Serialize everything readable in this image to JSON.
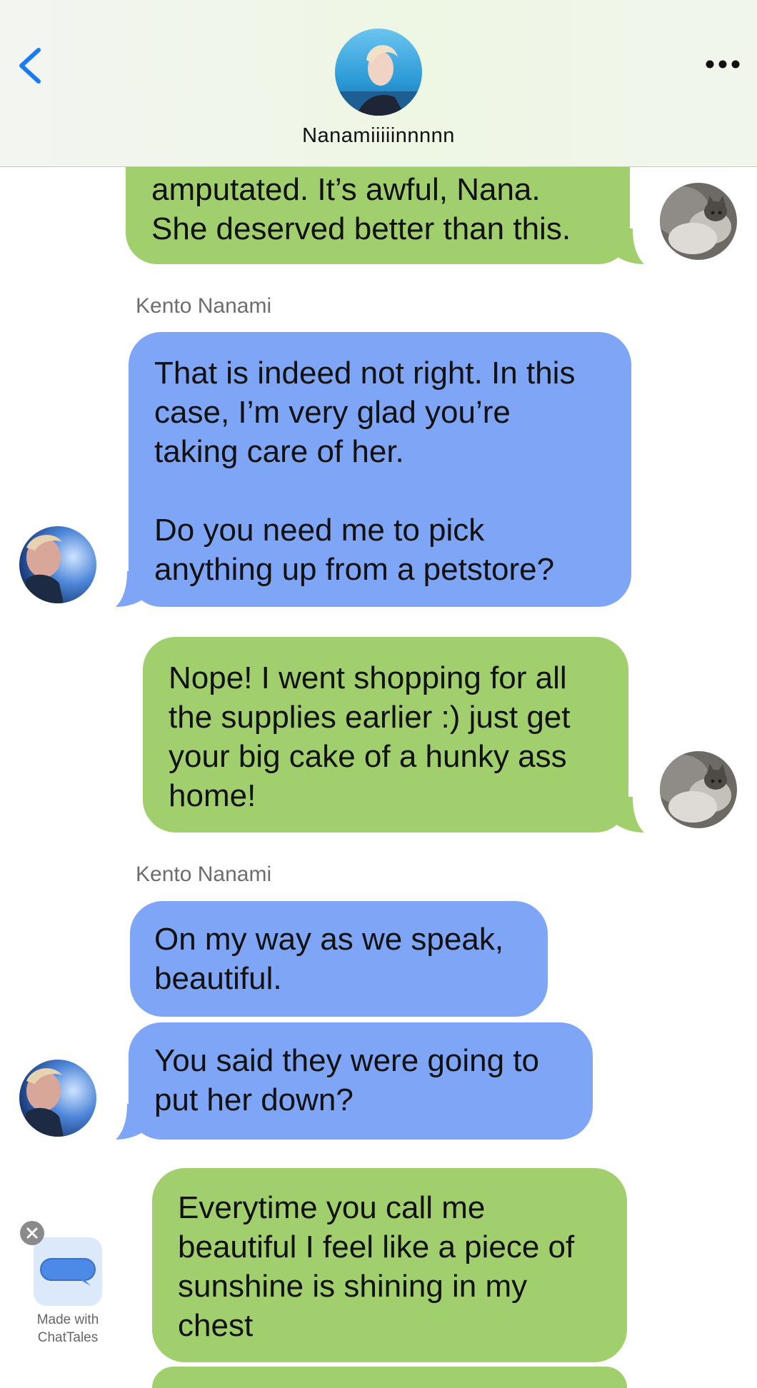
{
  "header": {
    "contact_name": "Nanamiiiiinnnnn",
    "back_icon": "chevron-left-icon",
    "more_icon": "ellipsis-icon"
  },
  "messages": [
    {
      "side": "right",
      "text": "amputated. It’s awful, Nana.\nShe deserved better than this."
    },
    {
      "side": "left",
      "sender": "Kento Nanami",
      "text": "That is indeed not right. In this\ncase, I’m very glad you’re\ntaking care of her.\n\nDo you need me to pick\nanything up from a petstore?"
    },
    {
      "side": "right",
      "text": "Nope! I went shopping for all\nthe supplies earlier :) just get\nyour big cake of a hunky ass\nhome!"
    },
    {
      "side": "left",
      "sender": "Kento Nanami",
      "text": "On my way as we speak,\nbeautiful."
    },
    {
      "side": "left",
      "text": "You said they were going to\nput her down?"
    },
    {
      "side": "right",
      "text": "Everytime you call me\nbeautiful I feel like a piece of\nsunshine is shining in my\nchest"
    }
  ],
  "promo": {
    "text": "Made with\nChatTales",
    "close_icon": "close-icon"
  },
  "colors": {
    "user_bubble": "#a2cf6e",
    "contact_bubble": "#7fa5f6",
    "accent": "#1a7cf5"
  }
}
